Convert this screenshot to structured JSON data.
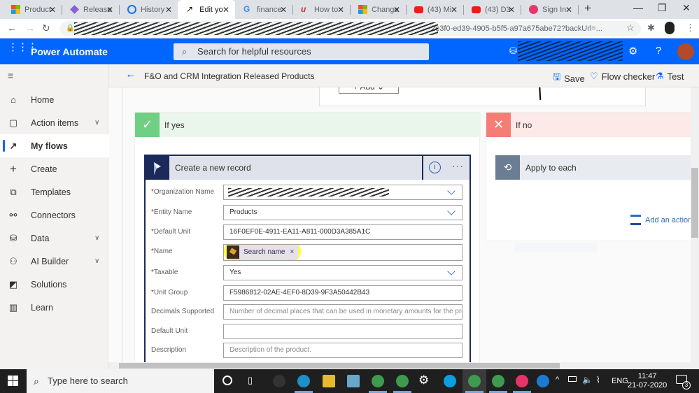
{
  "browser": {
    "tabs": [
      {
        "label": "Product",
        "icon": "microsoft-logo-icon",
        "active": false
      },
      {
        "label": "Release",
        "icon": "gem-icon",
        "active": false
      },
      {
        "label": "History",
        "icon": "history-icon",
        "active": false
      },
      {
        "label": "Edit yo",
        "icon": "power-automate-icon",
        "active": true
      },
      {
        "label": "finance",
        "icon": "google-icon",
        "active": false
      },
      {
        "label": "How to",
        "icon": "udemy-icon",
        "active": false
      },
      {
        "label": "Change",
        "icon": "microsoft-logo-icon",
        "active": false
      },
      {
        "label": "(43) Mi",
        "icon": "youtube-icon",
        "active": false
      },
      {
        "label": "(43) D3",
        "icon": "youtube-icon",
        "active": false
      },
      {
        "label": "Sign In",
        "icon": "signin-icon",
        "active": false
      }
    ],
    "new_tab": "+",
    "url_visible": "2e3f0-ed39-4905-b5f5-a97a675abe72?backUrl=..."
  },
  "app": {
    "name": "Power Automate",
    "search_placeholder": "Search for helpful resources"
  },
  "flow": {
    "title": "F&O and CRM Integration Released Products",
    "commands": {
      "save": "Save",
      "checker": "Flow checker",
      "test": "Test"
    }
  },
  "sidebar": {
    "items": [
      {
        "label": "Home",
        "icon": "home-icon",
        "chevron": false,
        "active": false
      },
      {
        "label": "Action items",
        "icon": "clipboard-icon",
        "chevron": true,
        "active": false
      },
      {
        "label": "My flows",
        "icon": "flow-icon",
        "chevron": false,
        "active": true
      },
      {
        "label": "Create",
        "icon": "plus-icon",
        "chevron": false,
        "active": false
      },
      {
        "label": "Templates",
        "icon": "templates-icon",
        "chevron": false,
        "active": false
      },
      {
        "label": "Connectors",
        "icon": "connectors-icon",
        "chevron": false,
        "active": false
      },
      {
        "label": "Data",
        "icon": "database-icon",
        "chevron": true,
        "active": false
      },
      {
        "label": "AI Builder",
        "icon": "ai-builder-icon",
        "chevron": true,
        "active": false
      },
      {
        "label": "Solutions",
        "icon": "solutions-icon",
        "chevron": false,
        "active": false
      },
      {
        "label": "Learn",
        "icon": "book-icon",
        "chevron": false,
        "active": false
      }
    ]
  },
  "canvas": {
    "add_button": "Add",
    "if_yes": "If yes",
    "if_no": "If no",
    "apply_to_each": "Apply to each",
    "add_an_action": "Add an action",
    "colors": {
      "yes": "#6fcf82",
      "yes_bg": "#eaf6ec",
      "no": "#f47d76",
      "no_bg": "#fde9e8",
      "card_dark": "#1c2a5b"
    },
    "card": {
      "title": "Create a new record",
      "fields": [
        {
          "label": "Organization Name",
          "required": true,
          "value": "",
          "placeholder": "",
          "dropdown": true,
          "redacted": true
        },
        {
          "label": "Entity Name",
          "required": true,
          "value": "Products",
          "placeholder": "",
          "dropdown": true
        },
        {
          "label": "Default Unit",
          "required": true,
          "value": "16F0EF0E-4911-EA11-A811-000D3A385A1C",
          "placeholder": "",
          "dropdown": false
        },
        {
          "label": "Name",
          "required": true,
          "value": "",
          "token": "Search name",
          "dropdown": false
        },
        {
          "label": "Taxable",
          "required": true,
          "value": "Yes",
          "placeholder": "",
          "dropdown": true
        },
        {
          "label": "Unit Group",
          "required": true,
          "value": "F5986812-02AE-4EF0-8D39-9F3A50442B43",
          "placeholder": "",
          "dropdown": false
        },
        {
          "label": "Decimals Supported",
          "required": false,
          "value": "",
          "placeholder": "Number of decimal places that can be used in monetary amounts for the produ",
          "dropdown": false
        },
        {
          "label": "Default Unit",
          "required": false,
          "value": "",
          "placeholder": "",
          "dropdown": false
        },
        {
          "label": "Description",
          "required": false,
          "value": "",
          "placeholder": "Description of the product.",
          "dropdown": false
        }
      ]
    }
  },
  "taskbar": {
    "search_placeholder": "Type here to search",
    "language": "ENG",
    "time": "11:47",
    "date": "21-07-2020",
    "notifications": "3"
  }
}
